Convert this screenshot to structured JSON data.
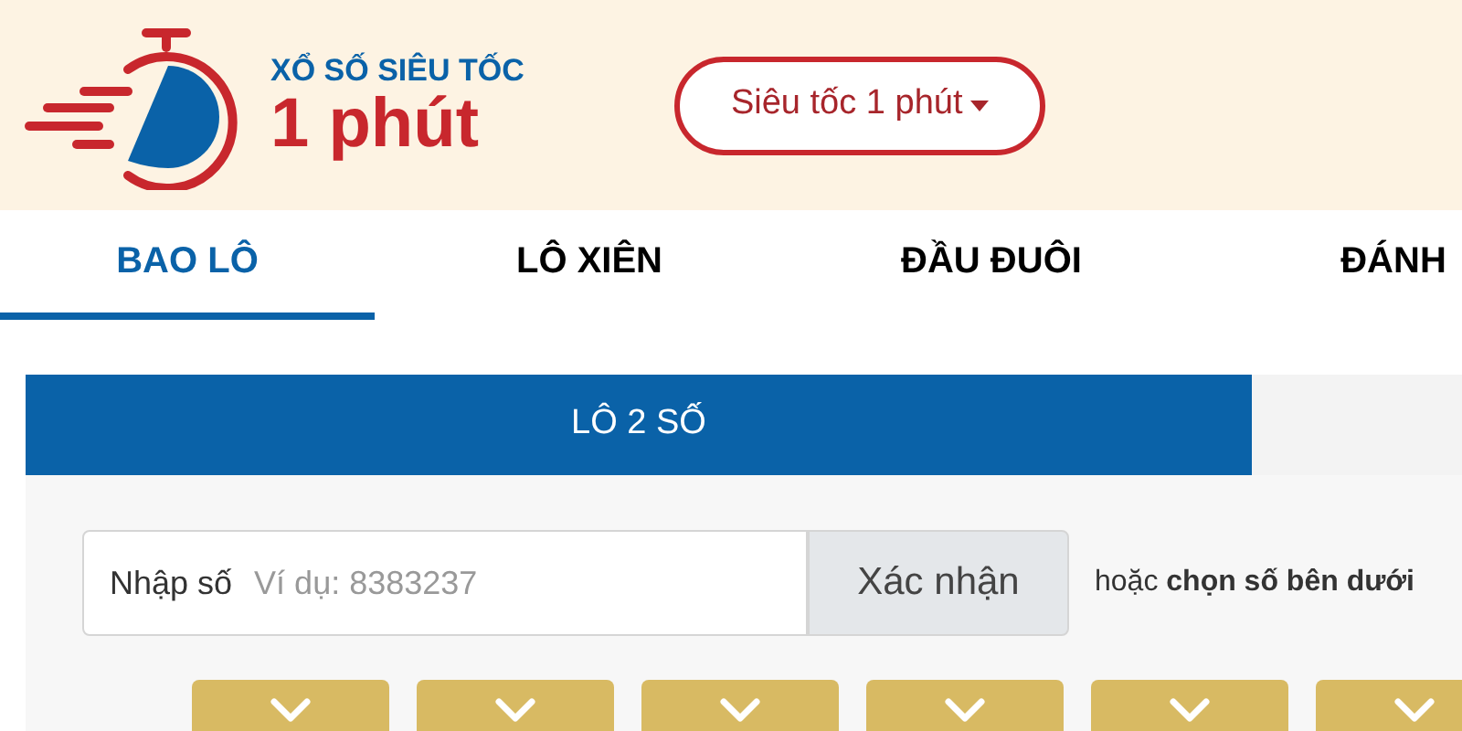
{
  "header": {
    "subtitle": "XỔ SỐ SIÊU TỐC",
    "title": "1 phút",
    "dropdown": "Siêu tốc 1 phút"
  },
  "tabs": [
    {
      "label": "BAO LÔ",
      "selected": true
    },
    {
      "label": "LÔ XIÊN",
      "selected": false
    },
    {
      "label": "ĐẦU ĐUÔI",
      "selected": false
    },
    {
      "label": "ĐÁNH",
      "selected": false
    }
  ],
  "subtabs": [
    {
      "label": "LÔ 2 SỐ",
      "selected": true
    }
  ],
  "entry": {
    "label": "Nhập số",
    "placeholder": "Ví dụ: 8383237",
    "button": "Xác nhận",
    "hint": "hoặc **chọn số bên dưới**"
  },
  "groups": [
    {
      "expanded": false
    },
    {
      "expanded": false
    },
    {
      "expanded": false
    },
    {
      "expanded": false
    },
    {
      "expanded": false
    },
    {
      "expanded": false
    }
  ]
}
